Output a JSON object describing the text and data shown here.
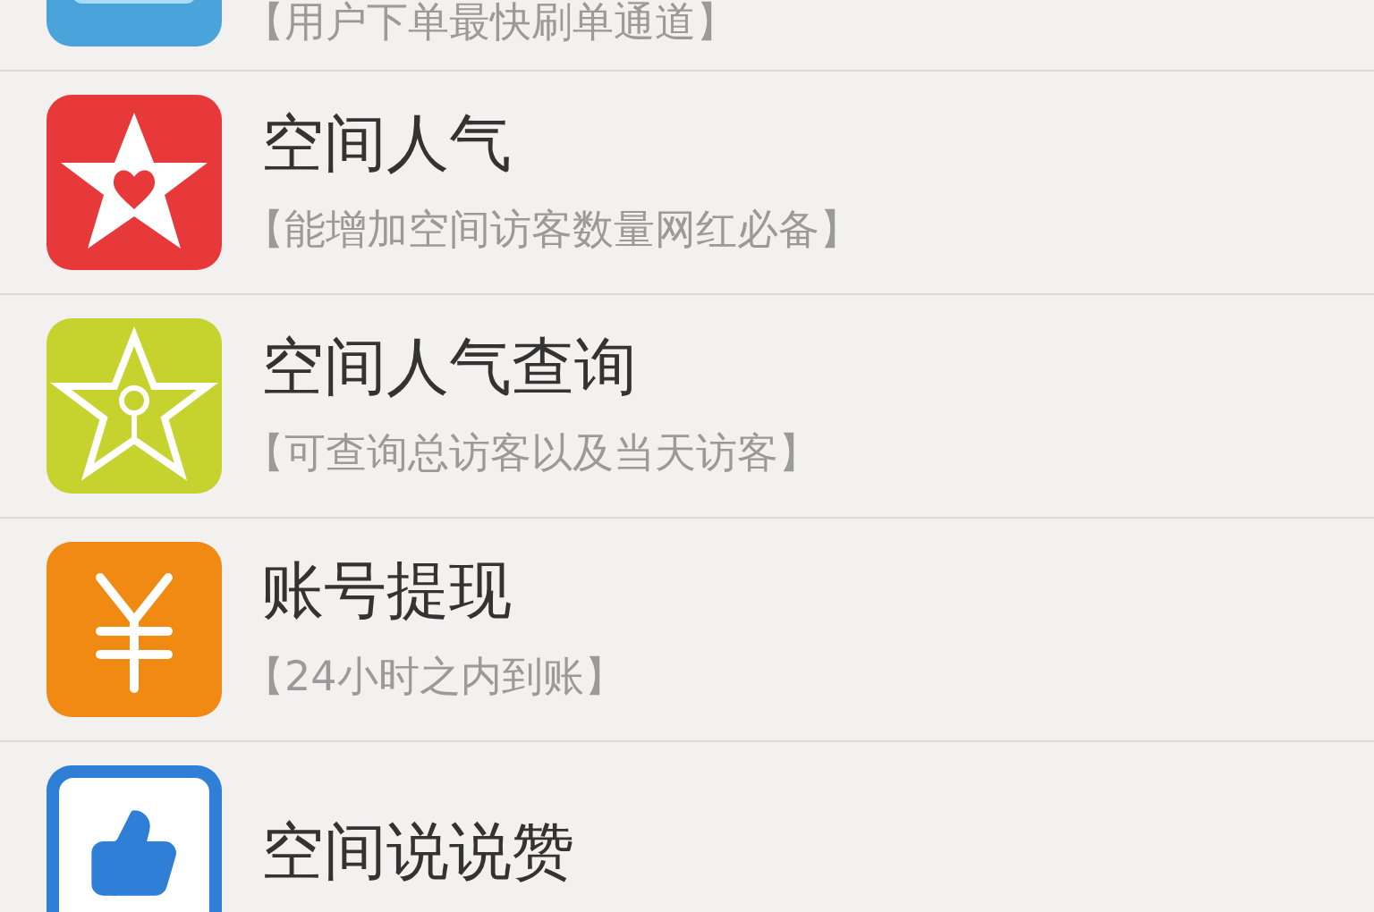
{
  "items": [
    {
      "kind": "order",
      "subtitle": "【用户下单最快刷单通道】"
    },
    {
      "kind": "popularity",
      "title": "空间人气",
      "subtitle": "【能增加空间访客数量网红必备】"
    },
    {
      "kind": "query",
      "title": "空间人气查询",
      "subtitle": "【可查询总访客以及当天访客】"
    },
    {
      "kind": "withdraw",
      "title": "账号提现",
      "subtitle": "【24小时之内到账】"
    },
    {
      "kind": "like",
      "title": "空间说说赞"
    }
  ]
}
